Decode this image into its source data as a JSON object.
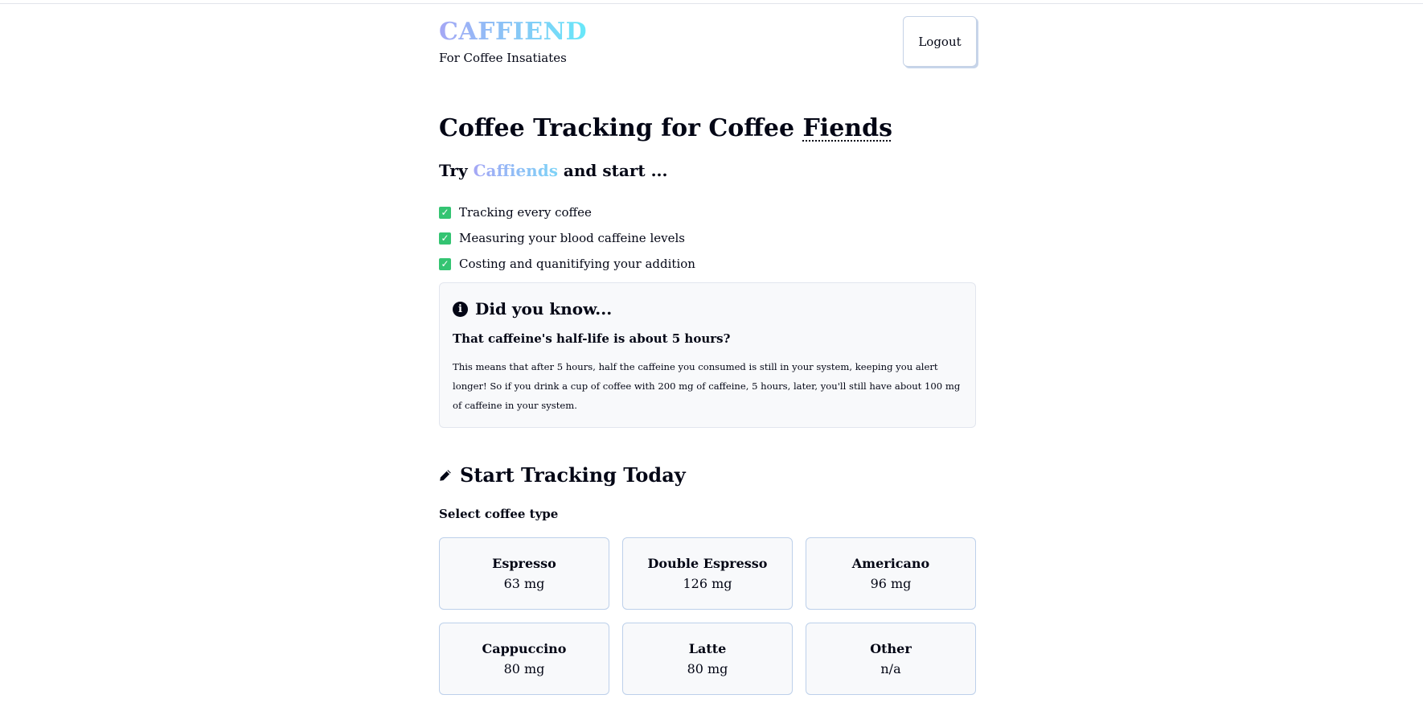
{
  "header": {
    "logo": "CAFFIEND",
    "tagline": "For Coffee Insatiates",
    "logout_label": "Logout"
  },
  "hero": {
    "title_prefix": "Coffee Tracking for Coffee ",
    "title_emphasis": "Fiends",
    "try_prefix": "Try ",
    "try_brand": "Caffiends",
    "try_suffix": " and start ...",
    "features": [
      "Tracking every coffee",
      "Measuring your blood caffeine levels",
      "Costing and quanitifying your addition"
    ]
  },
  "fact": {
    "heading": "Did you know...",
    "question": "That caffeine's half-life is about 5 hours?",
    "body": "This means that after 5 hours, half the caffeine you consumed is still in your system, keeping you alert longer! So if you drink a cup of coffee with 200 mg of caffeine, 5 hours, later, you'll still have about 100 mg of caffeine in your system."
  },
  "tracking": {
    "heading": "Start Tracking Today",
    "select_label": "Select coffee type",
    "coffees": [
      {
        "name": "Espresso",
        "caffeine": "63 mg"
      },
      {
        "name": "Double Espresso",
        "caffeine": "126 mg"
      },
      {
        "name": "Americano",
        "caffeine": "96 mg"
      },
      {
        "name": "Cappuccino",
        "caffeine": "80 mg"
      },
      {
        "name": "Latte",
        "caffeine": "80 mg"
      },
      {
        "name": "Other",
        "caffeine": "n/a"
      }
    ]
  },
  "icons": {
    "check": "check-square-icon",
    "info": "info-circle-icon",
    "pencil": "pencil-icon"
  },
  "colors": {
    "brand_gradient_start": "#a5a7f5",
    "brand_gradient_end": "#67e8f9",
    "check_green": "#34c472",
    "card_border": "#bdd0ea"
  }
}
